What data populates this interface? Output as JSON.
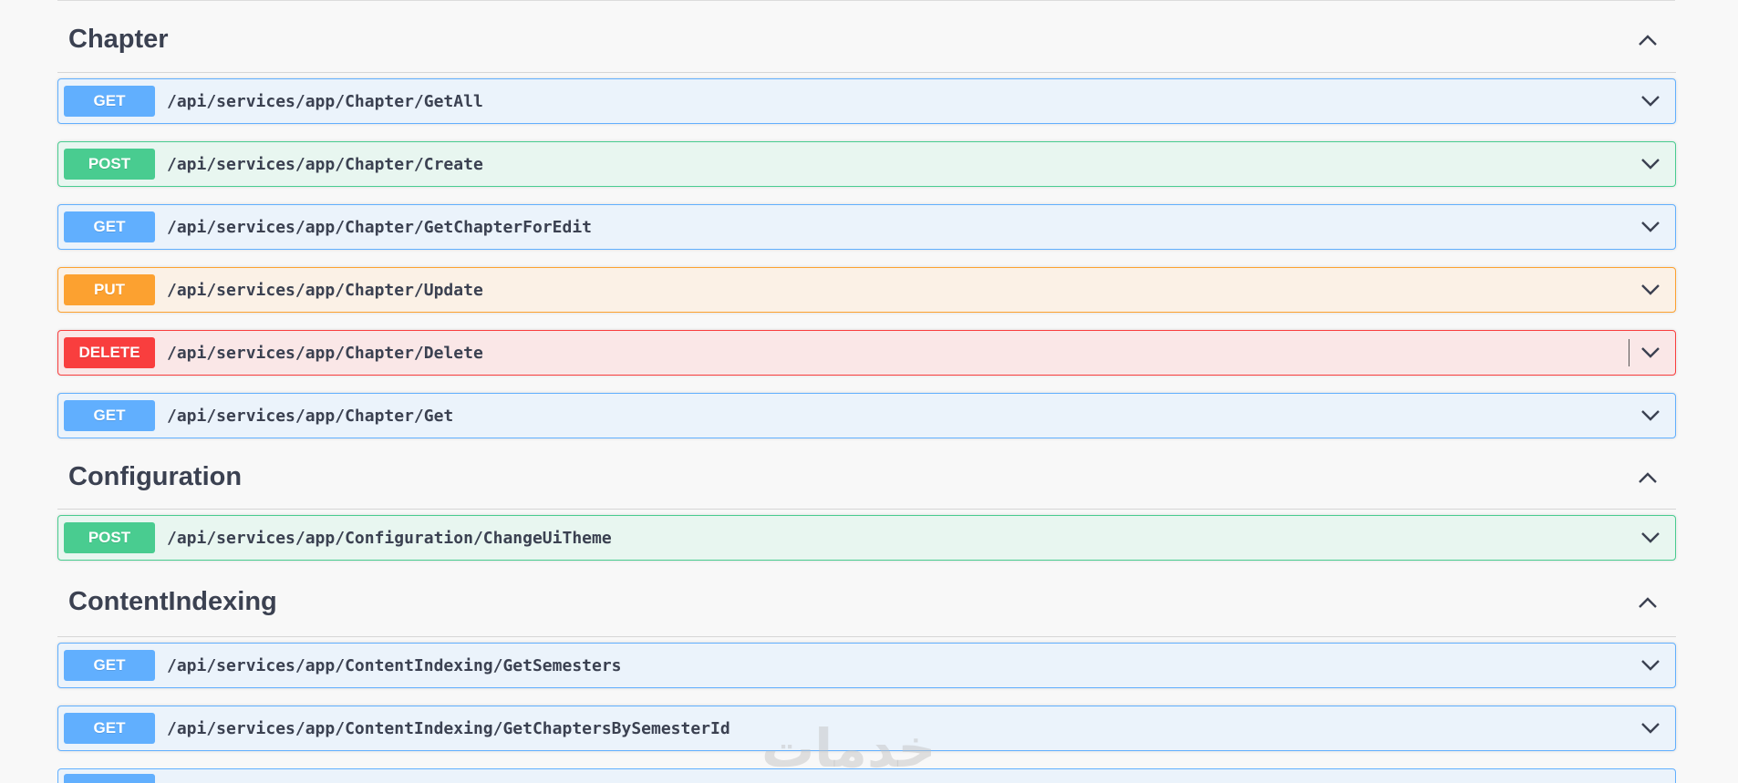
{
  "sections": [
    {
      "title": "Chapter",
      "ops": [
        {
          "method": "GET",
          "path": "/api/services/app/Chapter/GetAll"
        },
        {
          "method": "POST",
          "path": "/api/services/app/Chapter/Create"
        },
        {
          "method": "GET",
          "path": "/api/services/app/Chapter/GetChapterForEdit"
        },
        {
          "method": "PUT",
          "path": "/api/services/app/Chapter/Update"
        },
        {
          "method": "DELETE",
          "path": "/api/services/app/Chapter/Delete"
        },
        {
          "method": "GET",
          "path": "/api/services/app/Chapter/Get"
        }
      ]
    },
    {
      "title": "Configuration",
      "ops": [
        {
          "method": "POST",
          "path": "/api/services/app/Configuration/ChangeUiTheme"
        }
      ]
    },
    {
      "title": "ContentIndexing",
      "ops": [
        {
          "method": "GET",
          "path": "/api/services/app/ContentIndexing/GetSemesters"
        },
        {
          "method": "GET",
          "path": "/api/services/app/ContentIndexing/GetChaptersBySemesterId"
        }
      ]
    }
  ],
  "watermark": "خدمات",
  "icons": {
    "collapse": "chevron-up-icon",
    "expand": "chevron-down-icon"
  },
  "colors": {
    "get": "#61affe",
    "post": "#49cc90",
    "put": "#fca130",
    "delete": "#f93e3e"
  }
}
